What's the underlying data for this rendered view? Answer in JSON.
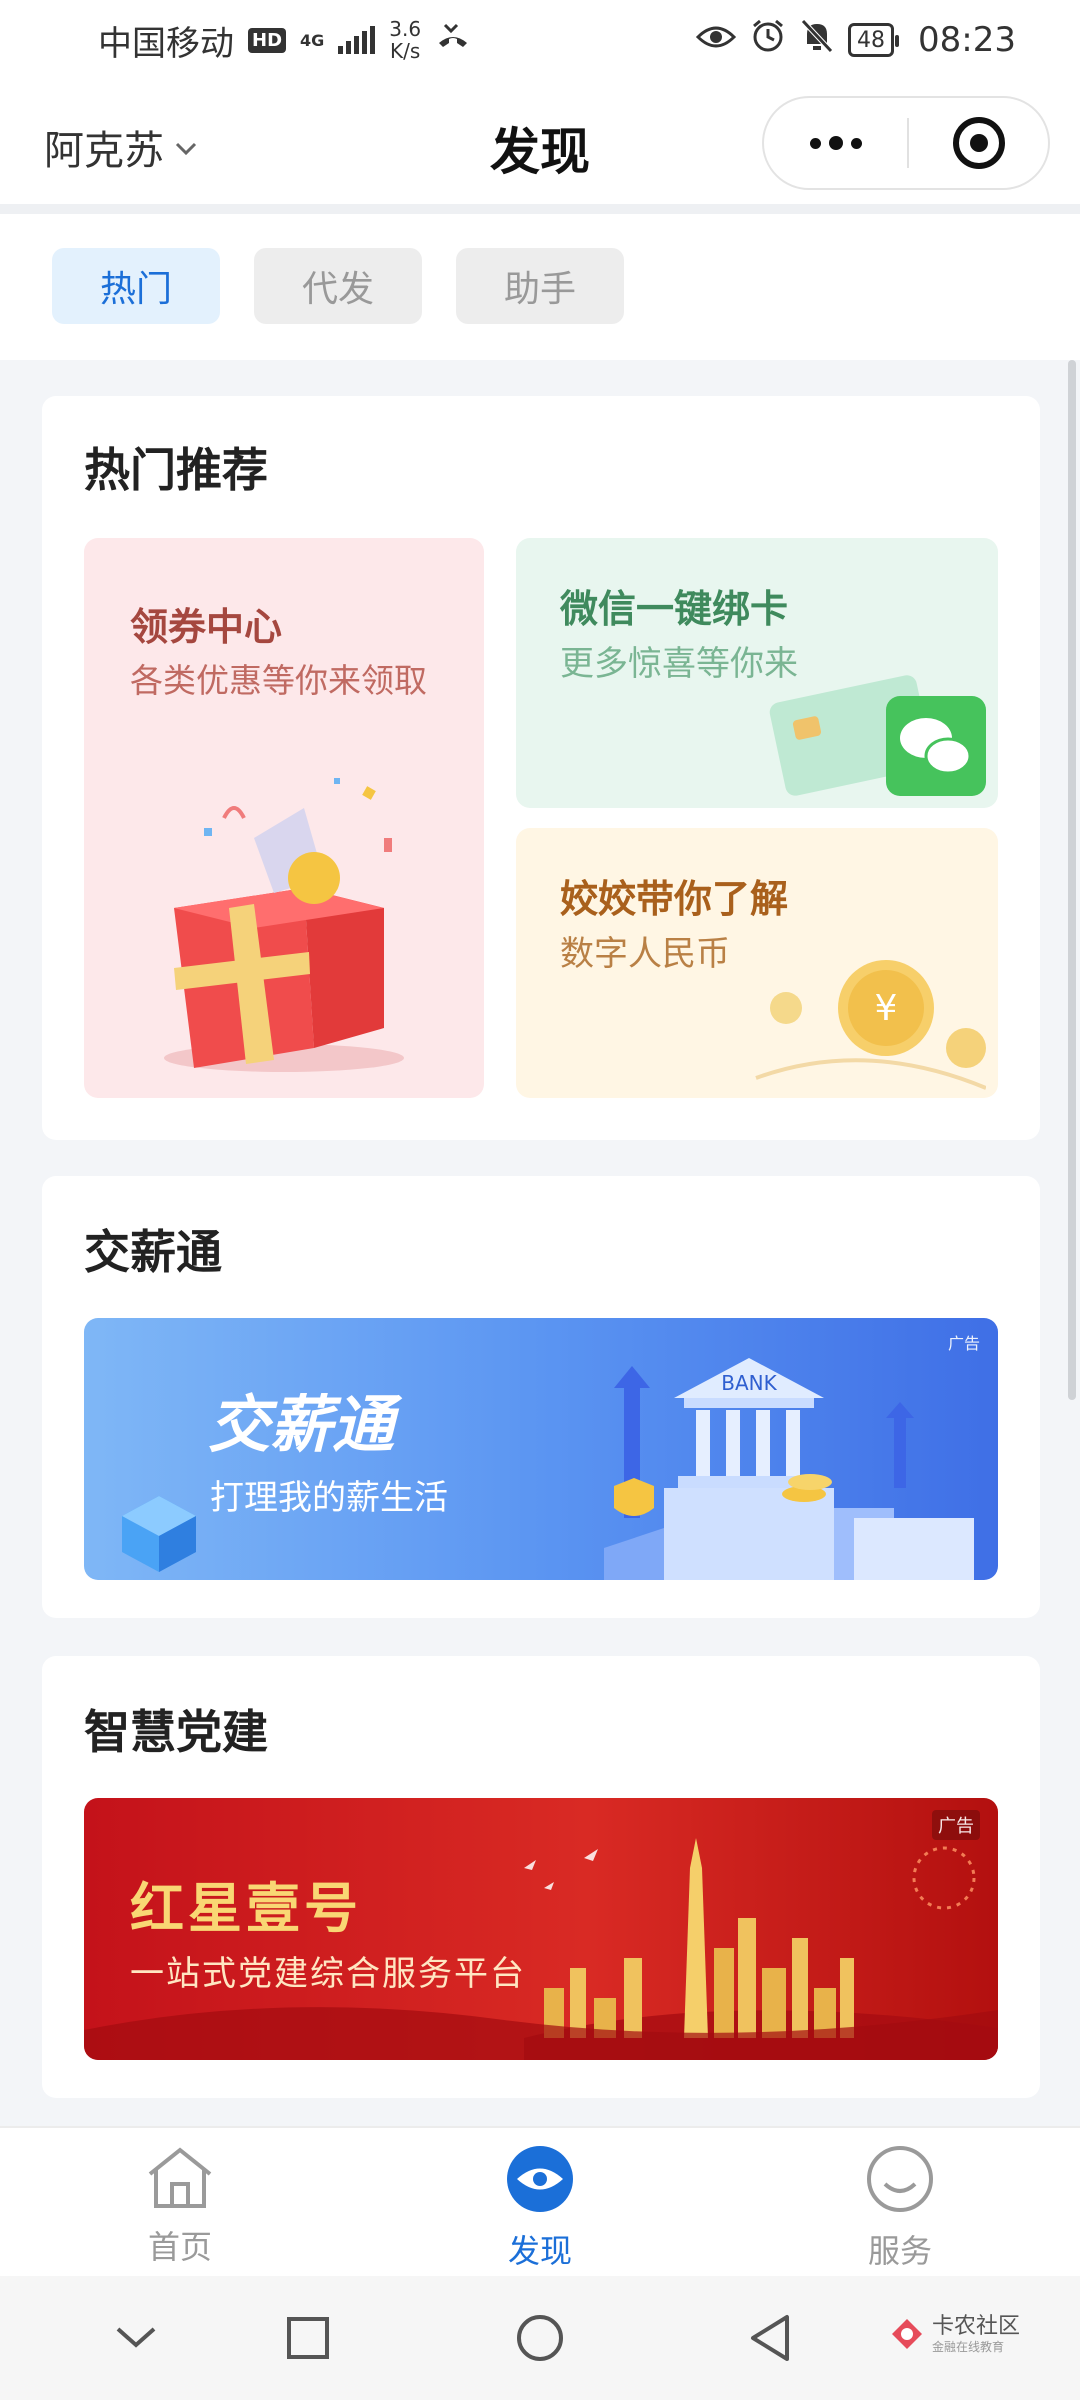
{
  "status_bar": {
    "carrier": "中国移动",
    "hd": "HD",
    "network": "4G",
    "speed_value": "3.6",
    "speed_unit": "K/s",
    "battery": "48",
    "time": "08:23"
  },
  "header": {
    "location": "阿克苏",
    "title": "发现"
  },
  "tabs": [
    {
      "label": "热门",
      "active": true
    },
    {
      "label": "代发",
      "active": false
    },
    {
      "label": "助手",
      "active": false
    }
  ],
  "hot_section": {
    "title": "热门推荐",
    "coupon": {
      "title": "领券中心",
      "subtitle": "各类优惠等你来领取"
    },
    "wechat": {
      "title": "微信一键绑卡",
      "subtitle": "更多惊喜等你来"
    },
    "rmb": {
      "title": "姣姣带你了解",
      "subtitle": "数字人民币"
    }
  },
  "salary_section": {
    "title": "交薪通",
    "banner_title": "交薪通",
    "banner_subtitle": "打理我的薪生活",
    "ad": "广告",
    "bank_label": "BANK"
  },
  "party_section": {
    "title": "智慧党建",
    "banner_title": "红星壹号",
    "banner_subtitle": "一站式党建综合服务平台",
    "ad": "广告"
  },
  "bottom_nav": [
    {
      "label": "首页",
      "active": false
    },
    {
      "label": "发现",
      "active": true
    },
    {
      "label": "服务",
      "active": false
    }
  ],
  "watermark": {
    "text": "卡农社区",
    "sub": "金融在线教育"
  },
  "colors": {
    "accent": "#1b6fd8",
    "coupon_bg": "#fde8ea",
    "wechat_bg": "#e8f6ef",
    "rmb_bg": "#fff6e4",
    "salary_banner": "#4a86f0",
    "party_banner": "#c8141b"
  }
}
